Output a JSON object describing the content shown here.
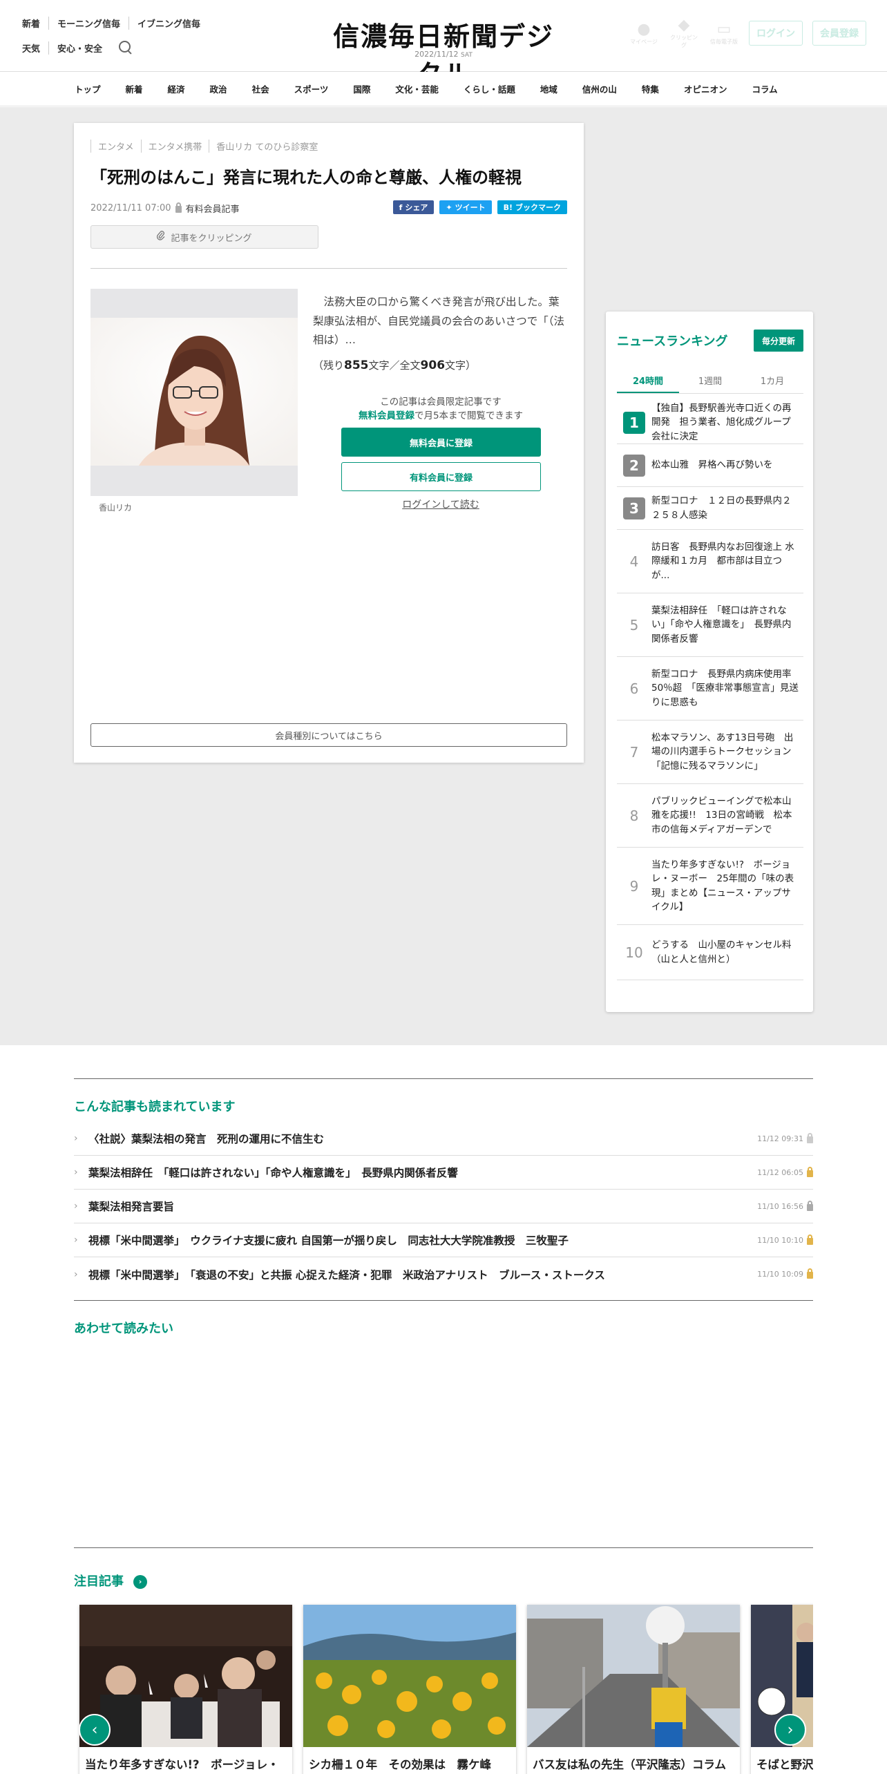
{
  "header": {
    "left_row1": [
      "新着",
      "モーニング信毎",
      "イブニング信毎"
    ],
    "left_row2": [
      "天気",
      "安心・安全"
    ],
    "logo": "信濃毎日新聞デジタル",
    "date": "2022/11/12",
    "weekday": "SAT",
    "right_icons": [
      "マイページ",
      "クリッピング",
      "信毎電子版"
    ],
    "login_label": "ログイン",
    "register_label": "会員登録"
  },
  "nav": [
    "トップ",
    "新着",
    "経済",
    "政治",
    "社会",
    "スポーツ",
    "国際",
    "文化・芸能",
    "くらし・話題",
    "地域",
    "信州の山",
    "特集",
    "オピニオン",
    "コラム"
  ],
  "article": {
    "breadcrumbs": [
      "エンタメ",
      "エンタメ携帯",
      "香山リカ てのひら診察室"
    ],
    "title": "「死刑のはんこ」発言に現れた人の命と尊厳、人権の軽視",
    "datetime": "2022/11/11 07:00",
    "paid_label": "有料会員記事",
    "share": {
      "facebook": "シェア",
      "twitter": "ツイート",
      "hatena": "ブックマーク"
    },
    "clip_label": "記事をクリッピング",
    "photo_caption": "香山リカ",
    "lead": "法務大臣の口から驚くべき発言が飛び出した。葉梨康弘法相が、自民党議員の会合のあいさつで「（法相は）…",
    "remaining_prefix": "（残り",
    "remaining_chars": "855",
    "remaining_mid": "文字／全文",
    "total_chars": "906",
    "remaining_suffix": "文字）",
    "members_only": "この記事は会員限定記事です",
    "free_link": "無料会員登録",
    "free_suffix": "で月5本まで閲覧できます",
    "register_free": "無料会員に登録",
    "register_paid": "有料会員に登録",
    "login_read": "ログインして読む",
    "member_types": "会員種別についてはこちら"
  },
  "ranking": {
    "title": "ニュースランキング",
    "badge": "毎分更新",
    "tabs": [
      "24時間",
      "1週間",
      "1カ月"
    ],
    "items": [
      {
        "rank": "1",
        "title": "【独自】長野駅善光寺口近くの再開発　担う業者、旭化成グループ会社に決定"
      },
      {
        "rank": "2",
        "title": "松本山雅　昇格へ再び勢いを"
      },
      {
        "rank": "3",
        "title": "新型コロナ　１２日の長野県内２２５８人感染"
      },
      {
        "rank": "4",
        "title": "訪日客　長野県内なお回復途上 水際緩和１カ月　都市部は目立つが..."
      },
      {
        "rank": "5",
        "title": "葉梨法相辞任　「軽口は許されない」「命や人権意識を」　長野県内関係者反響"
      },
      {
        "rank": "6",
        "title": "新型コロナ　長野県内病床使用率50％超　「医療非常事態宣言」見送りに思惑も"
      },
      {
        "rank": "7",
        "title": "松本マラソン、あす13日号砲　出場の川内選手らトークセッション「記憶に残るマラソンに」"
      },
      {
        "rank": "8",
        "title": "パブリックビューイングで松本山雅を応援!!　13日の宮崎戦　松本市の信毎メディアガーデンで"
      },
      {
        "rank": "9",
        "title": "当たり年多すぎない!?　ボージョレ・ヌーボー　25年間の「味の表現」まとめ【ニュース・アップサイクル】"
      },
      {
        "rank": "10",
        "title": "どうする　山小屋のキャンセル料（山と人と信州と）"
      }
    ]
  },
  "related": {
    "title": "こんな記事も読まれています",
    "items": [
      {
        "title": "〈社説〉葉梨法相の発言　死刑の運用に不信生む",
        "date": "11/12 09:31",
        "lock": "none"
      },
      {
        "title": "葉梨法相辞任　「軽口は許されない」「命や人権意識を」　長野県内関係者反響",
        "date": "11/12 06:05",
        "lock": "paid"
      },
      {
        "title": "葉梨法相発言要旨",
        "date": "11/10 16:56",
        "lock": "member"
      },
      {
        "title": "視標「米中間選挙」　ウクライナ支援に疲れ 自国第一が揺り戻し　同志社大大学院准教授　三牧聖子",
        "date": "11/10 10:10",
        "lock": "paid"
      },
      {
        "title": "視標「米中間選挙」　「衰退の不安」と共振 心捉えた経済・犯罪　米政治アナリスト　ブルース・ストークス",
        "date": "11/10 10:09",
        "lock": "paid"
      }
    ]
  },
  "recommend_title": "あわせて読みたい",
  "featured": {
    "title": "注目記事",
    "cards": [
      {
        "caption": "当たり年多すぎない!?　ボージョレ・"
      },
      {
        "caption": "シカ柵１０年　その効果は　霧ケ峰"
      },
      {
        "caption": "バス友は私の先生（平沢隆志）コラム"
      },
      {
        "caption": "そばと野沢"
      }
    ]
  }
}
